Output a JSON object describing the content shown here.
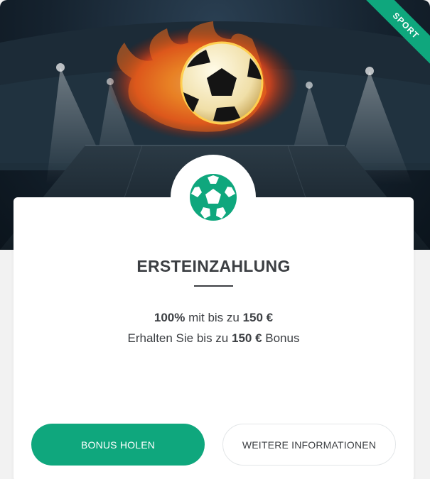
{
  "ribbon": {
    "label": "SPORT"
  },
  "offer": {
    "title": "ERSTEINZAHLUNG",
    "line1": {
      "percent": "100%",
      "middle": " mit bis zu ",
      "amount": "150 €"
    },
    "line2": {
      "prefix": "Erhalten Sie bis zu ",
      "amount": "150 €",
      "suffix": " Bonus"
    }
  },
  "buttons": {
    "primary": "BONUS HOLEN",
    "secondary": "WEITERE INFORMATIONEN"
  },
  "colors": {
    "accent": "#0fa77d",
    "text": "#3c3f43",
    "hero_dark": "#15222e"
  },
  "icons": {
    "badge": "soccer-ball-icon",
    "hero": "flaming-soccer-ball"
  }
}
